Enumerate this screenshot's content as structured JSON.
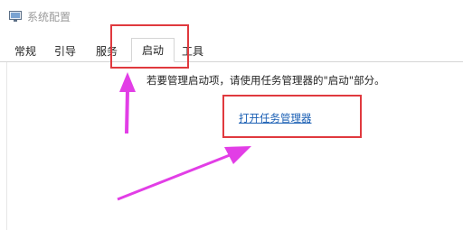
{
  "window": {
    "title": "系统配置"
  },
  "tabs": [
    {
      "label": "常规"
    },
    {
      "label": "引导"
    },
    {
      "label": "服务"
    },
    {
      "label": "启动"
    },
    {
      "label": "工具"
    }
  ],
  "startup": {
    "info": "若要管理启动项，请使用任务管理器的\"启动\"部分。",
    "link": "打开任务管理器"
  },
  "annotation": {
    "color": "#e0393e",
    "arrow_color": "#e23ee6"
  },
  "icons": {
    "app": "system-config-icon"
  }
}
